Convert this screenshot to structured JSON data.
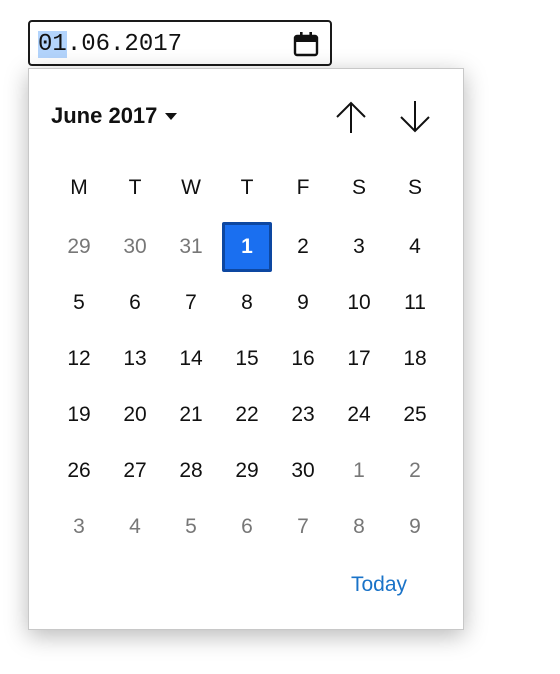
{
  "date_input": {
    "day": "01",
    "rest": ".06.2017",
    "calendar_icon": "calendar-icon"
  },
  "picker": {
    "month_label": "June 2017",
    "dropdown_icon": "caret-down-icon",
    "prev_icon": "arrow-up-icon",
    "next_icon": "arrow-down-icon",
    "weekdays": [
      "M",
      "T",
      "W",
      "T",
      "F",
      "S",
      "S"
    ],
    "weeks": [
      [
        {
          "d": "29",
          "other": true
        },
        {
          "d": "30",
          "other": true
        },
        {
          "d": "31",
          "other": true
        },
        {
          "d": "1",
          "selected": true
        },
        {
          "d": "2"
        },
        {
          "d": "3"
        },
        {
          "d": "4"
        }
      ],
      [
        {
          "d": "5"
        },
        {
          "d": "6"
        },
        {
          "d": "7"
        },
        {
          "d": "8"
        },
        {
          "d": "9"
        },
        {
          "d": "10"
        },
        {
          "d": "11"
        }
      ],
      [
        {
          "d": "12"
        },
        {
          "d": "13"
        },
        {
          "d": "14"
        },
        {
          "d": "15"
        },
        {
          "d": "16"
        },
        {
          "d": "17"
        },
        {
          "d": "18"
        }
      ],
      [
        {
          "d": "19"
        },
        {
          "d": "20"
        },
        {
          "d": "21"
        },
        {
          "d": "22"
        },
        {
          "d": "23"
        },
        {
          "d": "24"
        },
        {
          "d": "25"
        }
      ],
      [
        {
          "d": "26"
        },
        {
          "d": "27"
        },
        {
          "d": "28"
        },
        {
          "d": "29"
        },
        {
          "d": "30"
        },
        {
          "d": "1",
          "other": true
        },
        {
          "d": "2",
          "other": true
        }
      ],
      [
        {
          "d": "3",
          "other": true
        },
        {
          "d": "4",
          "other": true
        },
        {
          "d": "5",
          "other": true
        },
        {
          "d": "6",
          "other": true
        },
        {
          "d": "7",
          "other": true
        },
        {
          "d": "8",
          "other": true
        },
        {
          "d": "9",
          "other": true
        }
      ]
    ],
    "today_label": "Today"
  },
  "colors": {
    "selected_fill": "#1a6ff0",
    "selected_border": "#0d47a1",
    "link": "#1a73c8",
    "segment_highlight": "#b3d4fc"
  }
}
